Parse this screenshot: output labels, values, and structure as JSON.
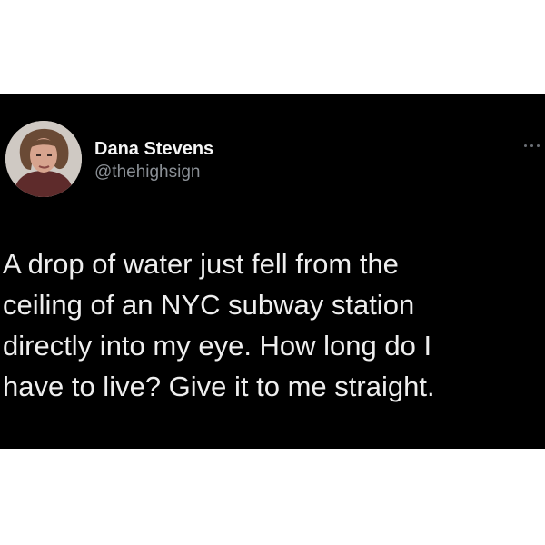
{
  "colors": {
    "page_background": "#ffffff",
    "card_background": "#000000",
    "name_color": "#f5f5f5",
    "handle_color": "#8b9096",
    "text_color": "#eeeeee"
  },
  "author": {
    "display_name": "Dana Stevens",
    "handle": "@thehighsign",
    "avatar_icon": "profile-photo"
  },
  "actions": {
    "more_icon": "more-horizontal-icon"
  },
  "tweet": {
    "lines": [
      "A drop of water just fell from the",
      "ceiling of an NYC subway station",
      "directly into my eye. How long do I",
      "have to live? Give it to me straight."
    ]
  }
}
